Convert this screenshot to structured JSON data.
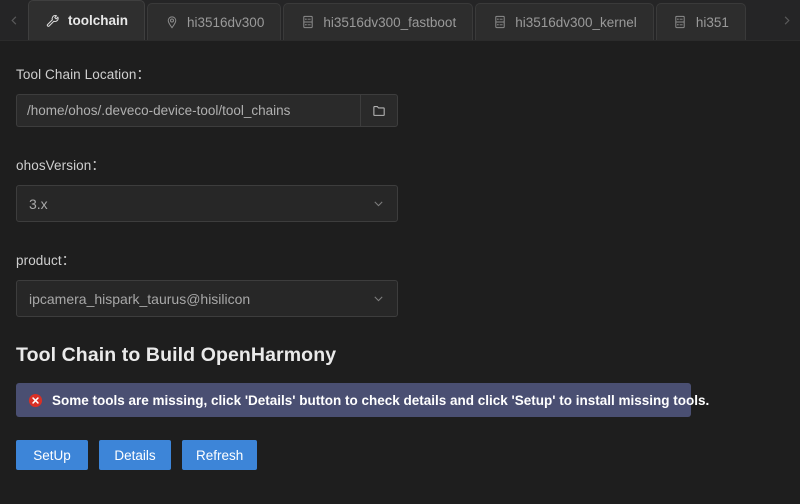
{
  "tabbar": {
    "scroll_left_icon": "chevron-left-icon",
    "scroll_right_icon": "chevron-right-icon",
    "tabs": [
      {
        "label": "toolchain",
        "icon": "wrench-icon",
        "active": true
      },
      {
        "label": "hi3516dv300",
        "icon": "location-pin-icon",
        "active": false
      },
      {
        "label": "hi3516dv300_fastboot",
        "icon": "device-board-icon",
        "active": false
      },
      {
        "label": "hi3516dv300_kernel",
        "icon": "device-board-icon",
        "active": false
      },
      {
        "label": "hi351",
        "icon": "device-board-icon",
        "active": false
      }
    ]
  },
  "form": {
    "location": {
      "label": "Tool Chain Location：",
      "value": "/home/ohos/.deveco-device-tool/tool_chains",
      "placeholder": "/home/ohos/.deveco-device-tool/tool_chains",
      "browse_icon": "folder-icon"
    },
    "ohos_version": {
      "label": "ohosVersion：",
      "value": "3.x",
      "arrow_icon": "chevron-down-icon"
    },
    "product": {
      "label": "product：",
      "value": "ipcamera_hispark_taurus@hisilicon",
      "arrow_icon": "chevron-down-icon"
    }
  },
  "section": {
    "title": "Tool Chain to Build OpenHarmony"
  },
  "alert": {
    "icon": "error-circle-icon",
    "message": "Some tools are missing, click 'Details' button to check details and click 'Setup' to install missing tools.",
    "background_color": "#4a4f72",
    "icon_color": "#d93025"
  },
  "buttons": [
    {
      "label": "SetUp"
    },
    {
      "label": "Details"
    },
    {
      "label": "Refresh"
    }
  ],
  "theme": {
    "background": "#1e1e1e",
    "tabbar_background": "#252526",
    "accent_blue": "#3d85d8"
  }
}
